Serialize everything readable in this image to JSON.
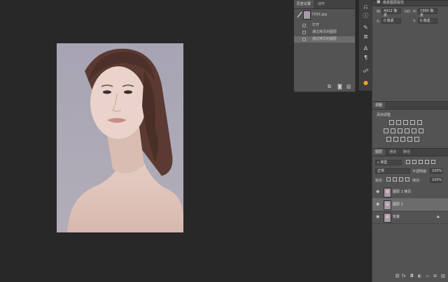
{
  "history_panel": {
    "tabs": [
      "历史记录",
      "动作"
    ],
    "snapshot_label": "7292.jpg",
    "steps": [
      "打开",
      "通过拷贝的图层",
      "通过拷贝的图层"
    ],
    "selected_step": 2
  },
  "properties": {
    "title": "像素图层属性",
    "w_label": "W:",
    "w_value": "4912 像素",
    "link_symbol": "GO",
    "h_label": "H:",
    "h_value": "7360 像素",
    "x_label": "X:",
    "x_value": "0 像素",
    "y_label": "Y:",
    "y_value": "0 像素"
  },
  "adjustments": {
    "tab": "调整",
    "add_label": "添加调整"
  },
  "layers_panel": {
    "tabs": [
      "图层",
      "通道",
      "路径"
    ],
    "filter_kind": "类型",
    "blend_mode": "正常",
    "opacity_label": "不透明度:",
    "opacity_value": "100%",
    "lock_label": "锁定:",
    "fill_label": "填充:",
    "fill_value": "100%",
    "layers": [
      {
        "name": "图层 1 拷贝",
        "selected": false
      },
      {
        "name": "图层 1",
        "selected": true
      },
      {
        "name": "背景",
        "selected": false
      }
    ]
  },
  "bottom_icons": [
    "link-icon",
    "fx-icon",
    "mask-icon",
    "adjustment-icon",
    "folder-icon",
    "new-layer-icon",
    "trash-icon"
  ]
}
